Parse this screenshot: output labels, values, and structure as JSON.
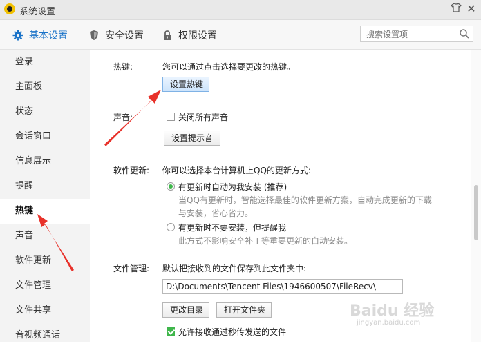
{
  "window": {
    "title": "系统设置",
    "tshirt_icon": "tshirt-icon",
    "close_icon": "close-icon"
  },
  "nav": {
    "tabs": [
      {
        "label": "基本设置",
        "icon": "gear-icon",
        "active": true
      },
      {
        "label": "安全设置",
        "icon": "shield-icon",
        "active": false
      },
      {
        "label": "权限设置",
        "icon": "lock-icon",
        "active": false
      }
    ],
    "search_placeholder": "搜索设置项"
  },
  "sidebar": {
    "items": [
      {
        "label": "登录"
      },
      {
        "label": "主面板"
      },
      {
        "label": "状态"
      },
      {
        "label": "会话窗口"
      },
      {
        "label": "信息展示"
      },
      {
        "label": "提醒"
      },
      {
        "label": "热键",
        "active": true
      },
      {
        "label": "声音"
      },
      {
        "label": "软件更新"
      },
      {
        "label": "文件管理"
      },
      {
        "label": "文件共享"
      },
      {
        "label": "音视频通话"
      }
    ]
  },
  "hotkey": {
    "label": "热键:",
    "desc": "您可以通过点击选择要更改的热键。",
    "button": "设置热键"
  },
  "sound": {
    "label": "声音:",
    "mute_all": "关闭所有声音",
    "mute_all_checked": false,
    "button": "设置提示音"
  },
  "update": {
    "label": "软件更新:",
    "desc": "你可以选择本台计算机上QQ的更新方式:",
    "option1": "有更新时自动为我安装 (推荐)",
    "option1_hint_line1": "当QQ有更新时，智能选择最佳的软件更新方案，自动完成更新的下载",
    "option1_hint_line2": "与安装，省心省力。",
    "option2": "有更新时不要安装，但提醒我",
    "option2_hint": "此方式不影响安全补丁等重要更新的自动安装。",
    "selected": 1
  },
  "files": {
    "label": "文件管理:",
    "desc": "默认把接收到的文件保存到此文件夹中:",
    "path": "D:\\Documents\\Tencent Files\\1946600507\\FileRecv\\",
    "change_button": "更改目录",
    "open_button": "打开文件夹",
    "fast_receive": "允许接收通过秒传发送的文件",
    "fast_receive_checked": true
  },
  "watermark": {
    "brand": "Baidu 经验",
    "url": "jingyan.baidu.com"
  },
  "colors": {
    "accent": "#1a73c8",
    "checkbox_green": "#3fb64b",
    "arrow_red": "#e8312a"
  }
}
